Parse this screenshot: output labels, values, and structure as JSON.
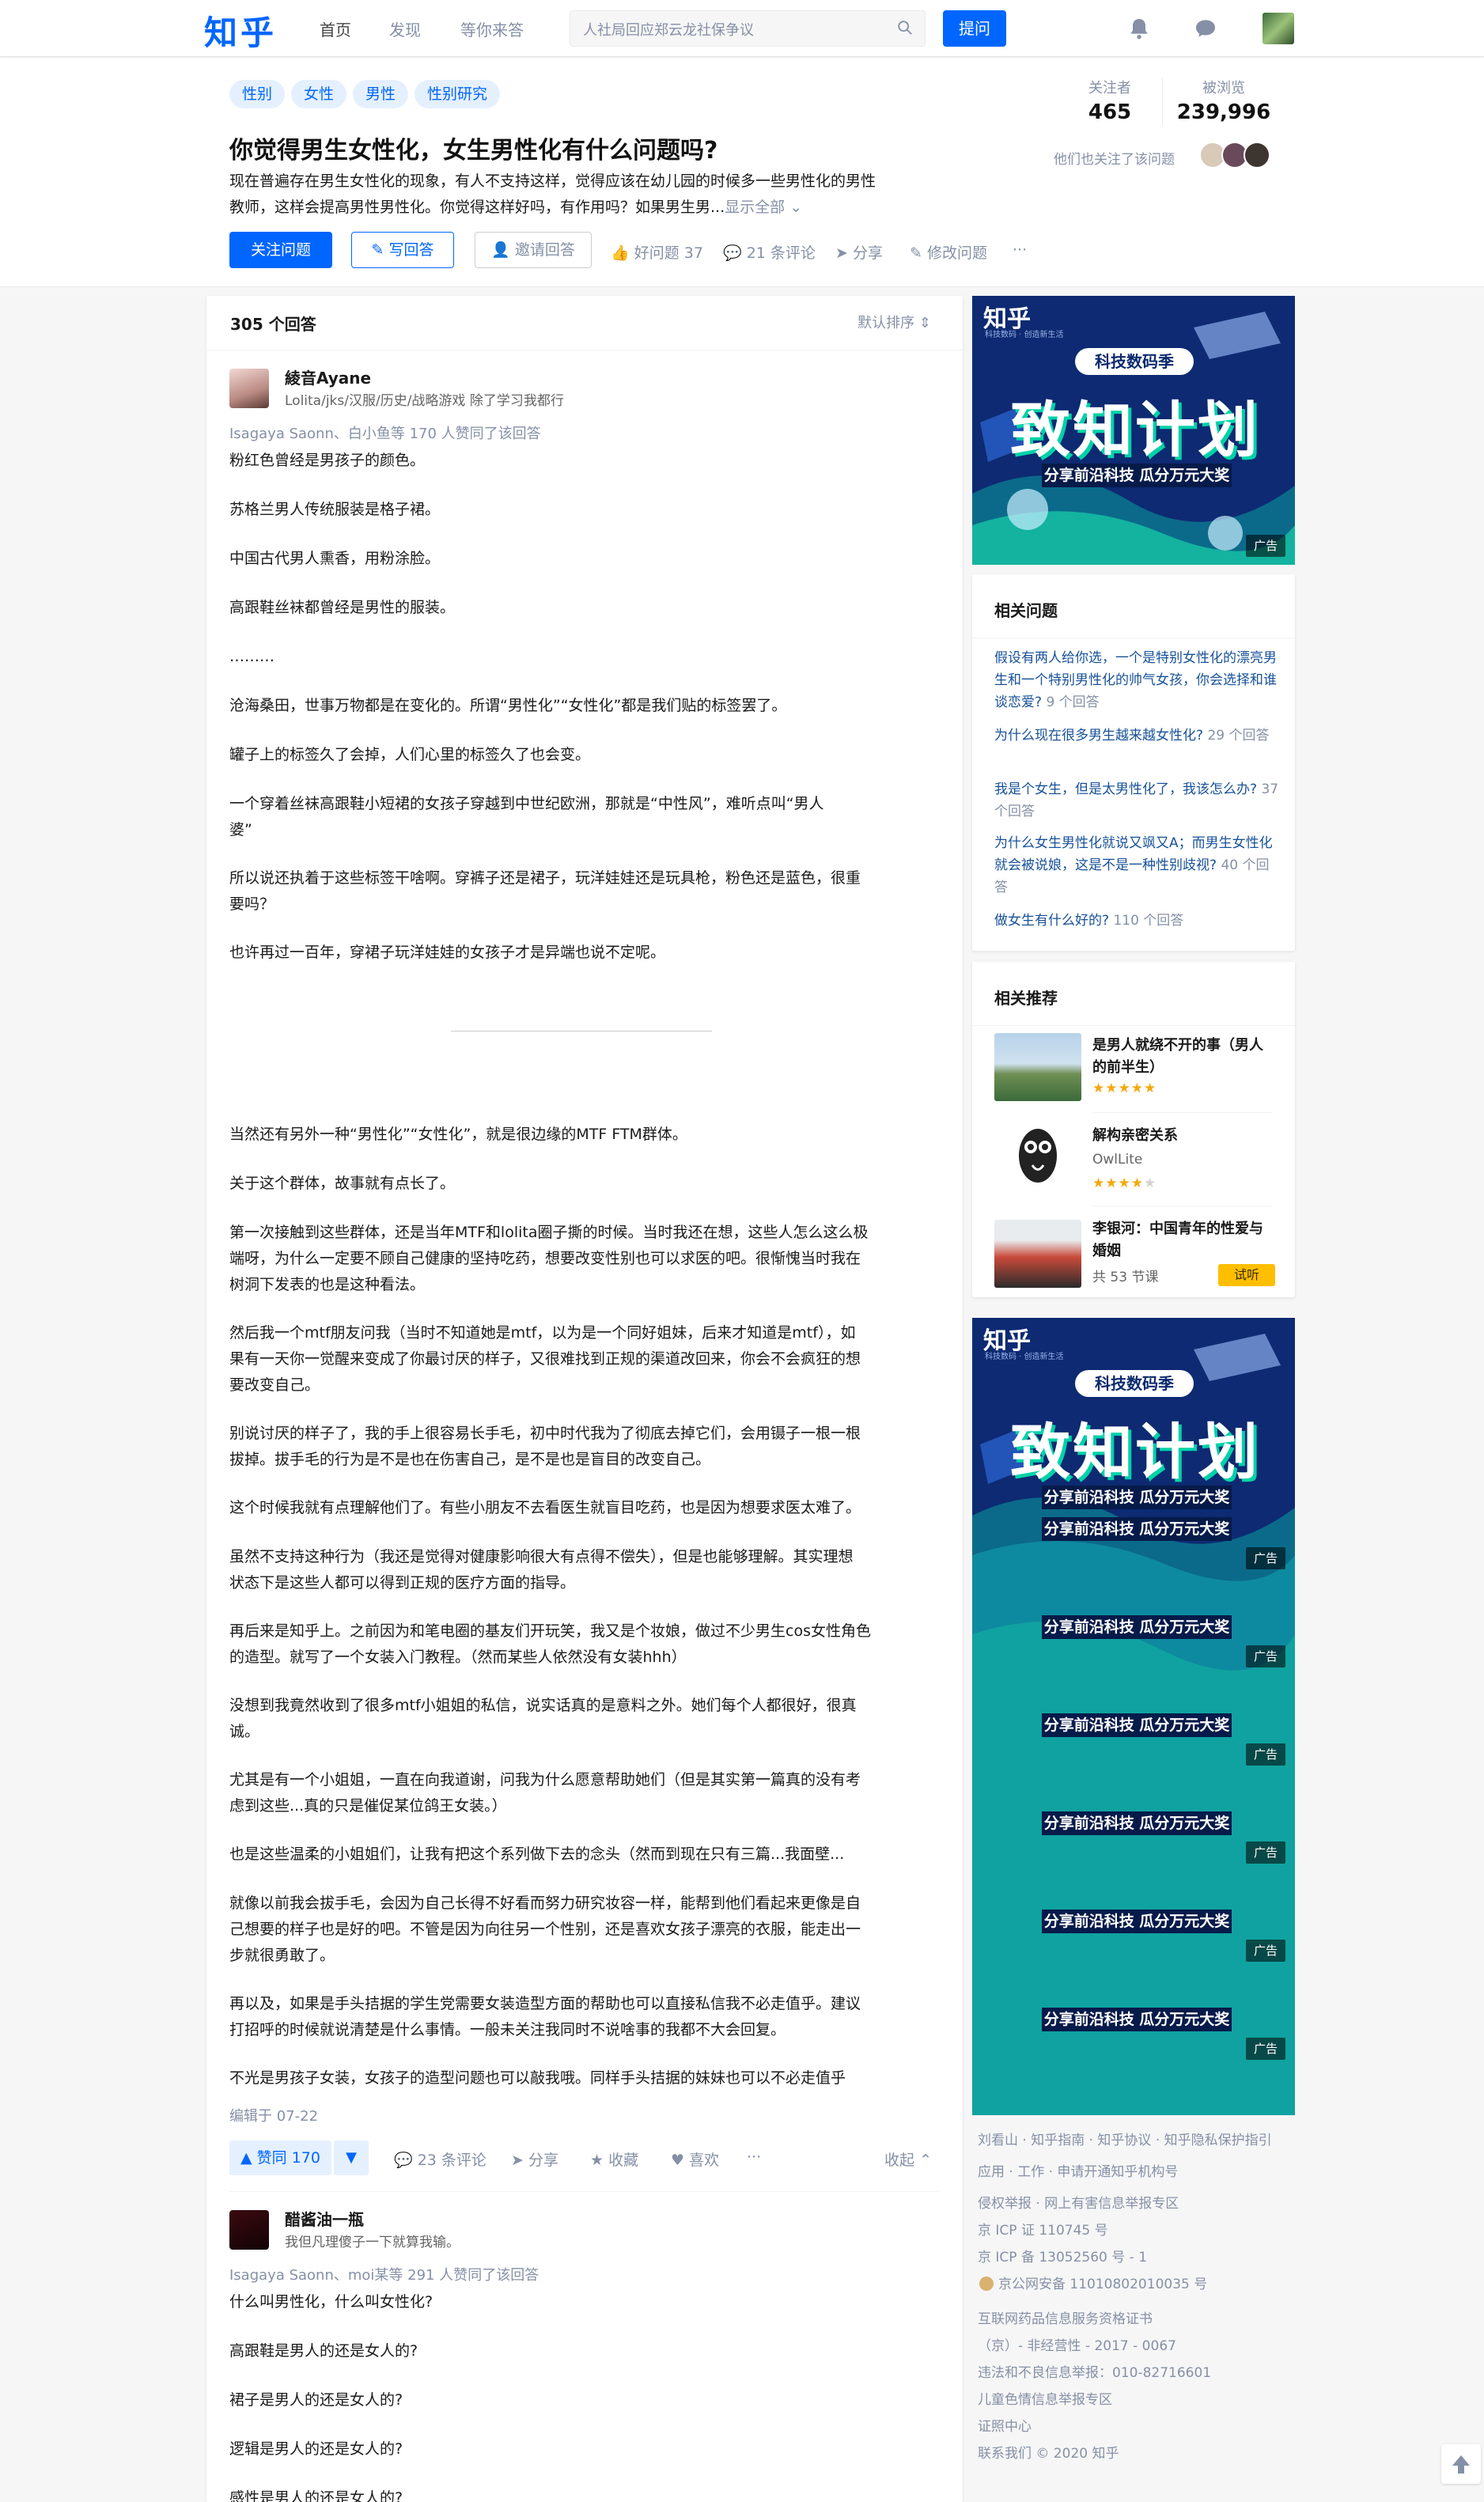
{
  "topbar": {
    "logo": "知乎",
    "nav": [
      "首页",
      "发现",
      "等你来答"
    ],
    "search_placeholder": "人社局回应郑云龙社保争议",
    "ask_label": "提问"
  },
  "question": {
    "tags": [
      "性别",
      "女性",
      "男性",
      "性别研究"
    ],
    "title": "你觉得男生女性化，女生男性化有什么问题吗?",
    "detail_line1": "现在普遍存在男生女性化的现象，有人不支持这样，觉得应该在幼儿园的时候多一些男性化的男性",
    "detail_line2": "教师，这样会提高男性男性化。你觉得这样好吗，有作用吗？如果男生男...",
    "show_all": "显示全部",
    "follow_label": "关注问题",
    "write_label": "写回答",
    "invite_label": "邀请回答",
    "good_q": "好问题 37",
    "comments": "21 条评论",
    "share": "分享",
    "edit": "修改问题",
    "more": "···",
    "followers_label": "关注者",
    "followers": "465",
    "views_label": "被浏览",
    "views": "239,996",
    "also_followed": "他们也关注了该问题"
  },
  "answers": {
    "count_label": "305 个回答",
    "sort_label": "默认排序",
    "list": [
      {
        "author": "綾音Ayane",
        "bio": "Lolita/jks/汉服/历史/战略游戏 除了学习我都行",
        "voters": "Isagaya Saonn、白小鱼等 170 人赞同了该回答",
        "paragraphs": [
          "粉红色曾经是男孩子的颜色。",
          "苏格兰男人传统服装是格子裙。",
          "中国古代男人熏香，用粉涂脸。",
          "高跟鞋丝袜都曾经是男性的服装。",
          "………",
          "沧海桑田，世事万物都是在变化的。所谓“男性化”“女性化”都是我们贴的标签罢了。",
          "罐子上的标签久了会掉，人们心里的标签久了也会变。",
          "一个穿着丝袜高跟鞋小短裙的女孩子穿越到中世纪欧洲，那就是“中性风”，难听点叫“男人|婆”",
          "所以说还执着于这些标签干啥啊。穿裤子还是裙子，玩洋娃娃还是玩具枪，粉色还是蓝色，很重|要吗？",
          "也许再过一百年，穿裙子玩洋娃娃的女孩子才是异端也说不定呢。",
          "当然还有另外一种“男性化”“女性化”，就是很边缘的MTF FTM群体。",
          "关于这个群体，故事就有点长了。",
          "第一次接触到这些群体，还是当年MTF和lolita圈子撕的时候。当时我还在想，这些人怎么这么极|端呀，为什么一定要不顾自己健康的坚持吃药，想要改变性别也可以求医的吧。很惭愧当时我在|树洞下发表的也是这种看法。",
          "然后我一个mtf朋友问我（当时不知道她是mtf，以为是一个同好姐妹，后来才知道是mtf），如|果有一天你一觉醒来变成了你最讨厌的样子，又很难找到正规的渠道改回来，你会不会疯狂的想|要改变自己。",
          "别说讨厌的样子了，我的手上很容易长手毛，初中时代我为了彻底去掉它们，会用镊子一根一根|拔掉。拔手毛的行为是不是也在伤害自己，是不是也是盲目的改变自己。",
          "这个时候我就有点理解他们了。有些小朋友不去看医生就盲目吃药，也是因为想要求医太难了。",
          "虽然不支持这种行为（我还是觉得对健康影响很大有点得不偿失），但是也能够理解。其实理想|状态下是这些人都可以得到正规的医疗方面的指导。",
          "再后来是知乎上。之前因为和笔电圈的基友们开玩笑，我又是个妆娘，做过不少男生cos女性角色|的造型。就写了一个女装入门教程。（然而某些人依然没有女装hhh）",
          "没想到我竟然收到了很多mtf小姐姐的私信，说实话真的是意料之外。她们每个人都很好，很真|诚。",
          "尤其是有一个小姐姐，一直在向我道谢，问我为什么愿意帮助她们（但是其实第一篇真的没有考|虑到这些...真的只是催促某位鸽王女装。）",
          "也是这些温柔的小姐姐们，让我有把这个系列做下去的念头（然而到现在只有三篇...我面壁...",
          "就像以前我会拔手毛，会因为自己长得不好看而努力研究妆容一样，能帮到他们看起来更像是自|己想要的样子也是好的吧。不管是因为向往另一个性别，还是喜欢女孩子漂亮的衣服，能走出一|步就很勇敢了。",
          "再以及，如果是手头拮据的学生党需要女装造型方面的帮助也可以直接私信我不必走值乎。建议|打招呼的时候就说清楚是什么事情。一般未关注我同时不说啥事的我都不大会回复。",
          "不光是男孩子女装，女孩子的造型问题也可以敲我哦。同样手头拮据的妹妹也可以不必走值乎"
        ],
        "edited": "编辑于 07-22",
        "upvote": "赞同 170",
        "comments": "23 条评论",
        "share": "分享",
        "collect": "收藏",
        "like": "喜欢",
        "more": "···",
        "collapse": "收起"
      },
      {
        "author": "醋酱油一瓶",
        "bio": "我但凡理傻子一下就算我输。",
        "voters": "Isagaya Saonn、moi某等 291 人赞同了该回答",
        "paragraphs": [
          "什么叫男性化，什么叫女性化?",
          "高跟鞋是男人的还是女人的?",
          "裙子是男人的还是女人的?",
          "逻辑是男人的还是女人的?",
          "感性是男人的还是女人的?"
        ]
      }
    ]
  },
  "ad": {
    "logo": "知乎",
    "sub": "科技数码 · 创造新生活",
    "season": "科技数码季",
    "title": "致知计划",
    "slogan": "分享前沿科技 瓜分万元大奖",
    "tag": "广告"
  },
  "related": {
    "title": "相关问题",
    "items": [
      {
        "q": "假设有两人给你选，一个是特别女性化的漂亮男生和一个特别男性化的帅气女孩，你会选择和谁谈恋爱?",
        "cnt": "9 个回答"
      },
      {
        "q": "为什么现在很多男生越来越女性化?",
        "cnt": "29 个回答"
      },
      {
        "q": "我是个女生，但是太男性化了，我该怎么办?",
        "cnt": "37 个回答"
      },
      {
        "q": "为什么女生男性化就说又飒又A；而男生女性化就会被说娘，这是不是一种性别歧视?",
        "cnt": "40 个回答"
      },
      {
        "q": "做女生有什么好的?",
        "cnt": "110 个回答"
      }
    ]
  },
  "recommend": {
    "title": "相关推荐",
    "items": [
      {
        "title": "是男人就绕不开的事（男人的前半生）",
        "sub": "",
        "stars": 5
      },
      {
        "title": "解构亲密关系",
        "sub": "OwlLite",
        "stars": 4
      },
      {
        "title": "李银河：中国青年的性爱与婚姻",
        "sub": "共 53 节课",
        "trial": "试听"
      }
    ]
  },
  "footer": {
    "lines": [
      "刘看山 · 知乎指南 · 知乎协议 · 知乎隐私保护指引",
      "应用 · 工作 · 申请开通知乎机构号",
      "侵权举报 · 网上有害信息举报专区",
      "京 ICP 证 110745 号",
      "京 ICP 备 13052560 号 - 1",
      "京公网安备 11010802010035 号",
      "互联网药品信息服务资格证书",
      "（京）- 非经营性 - 2017 - 0067",
      "违法和不良信息举报：010-82716601",
      "儿童色情信息举报专区",
      "证照中心",
      "联系我们 © 2020 知乎"
    ]
  }
}
